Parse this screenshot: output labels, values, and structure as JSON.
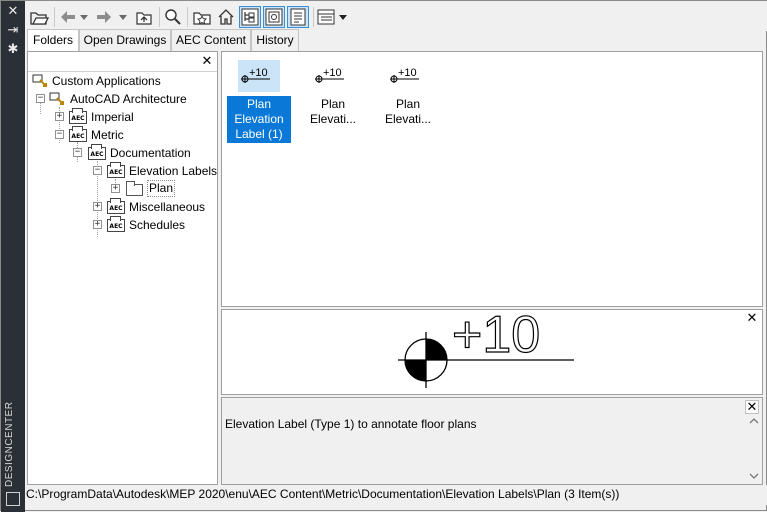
{
  "palette": "DESIGNCENTER",
  "side_icons": [
    "close-icon",
    "autohide-icon",
    "properties-icon"
  ],
  "toolbar": {
    "buttons": [
      "load-icon",
      "back-icon",
      "back-dropdown-icon",
      "forward-icon",
      "forward-dropdown-icon",
      "up-icon",
      "search-icon",
      "favorites-icon",
      "home-icon",
      "tree-view-toggle-icon",
      "preview-toggle-icon",
      "description-toggle-icon",
      "views-icon",
      "views-dropdown-icon"
    ]
  },
  "tabs": [
    "Folders",
    "Open Drawings",
    "AEC Content",
    "History"
  ],
  "tree": {
    "nodes": [
      {
        "label": "Custom Applications",
        "icon": "custom-apps-icon"
      },
      {
        "label": "AutoCAD Architecture",
        "expander": "⊟"
      },
      {
        "label": "Imperial",
        "expander": "+"
      },
      {
        "label": "Metric",
        "expander": "−"
      },
      {
        "label": "Documentation",
        "expander": "−"
      },
      {
        "label": "Elevation Labels",
        "expander": "−"
      },
      {
        "label": "Plan",
        "expander": "+"
      },
      {
        "label": "Miscellaneous",
        "expander": "+"
      },
      {
        "label": "Schedules",
        "expander": "+"
      }
    ]
  },
  "items": [
    {
      "label": "Plan\nElevation\nLabel (1)",
      "thumb_text": "+10",
      "selected": true
    },
    {
      "label": "Plan\nElevati...",
      "thumb_text": "+10",
      "selected": false
    },
    {
      "label": "Plan\nElevati...",
      "thumb_text": "+10",
      "selected": false
    }
  ],
  "preview": {
    "text": "+10"
  },
  "description": {
    "text": "Elevation Label (Type 1) to annotate floor plans"
  },
  "status": {
    "path": "C:\\ProgramData\\Autodesk\\MEP 2020\\enu\\AEC Content\\Metric\\Documentation\\Elevation Labels\\Plan (3 Item(s))"
  },
  "colors": {
    "selection": "#0a78d7",
    "selection_light": "#cce4f7",
    "titlebar": "#2b2f36"
  }
}
